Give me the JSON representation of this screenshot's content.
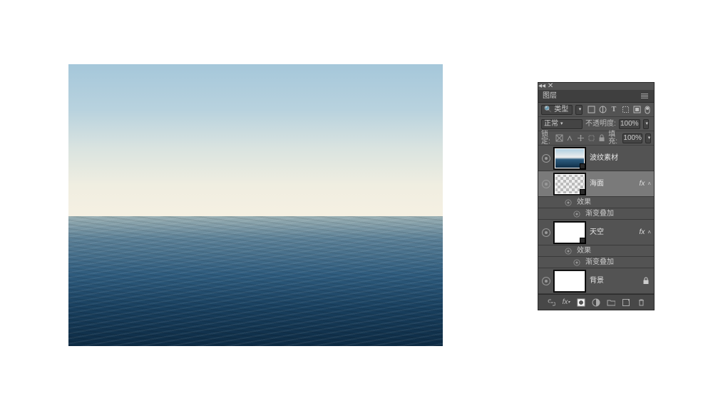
{
  "panel": {
    "title": "图层",
    "filter_label": "类型",
    "blend_mode": "正常",
    "opacity_label": "不透明度:",
    "opacity_value": "100%",
    "lock_label": "锁定:",
    "fill_label": "填充:",
    "fill_value": "100%"
  },
  "layers": [
    {
      "name": "波纹素材",
      "visible": true,
      "thumb": "sea",
      "selected": false,
      "fx": false,
      "locked": false
    },
    {
      "name": "海面",
      "visible": true,
      "thumb": "checker",
      "selected": true,
      "fx": true,
      "locked": false,
      "effects": {
        "label": "效果",
        "items": [
          "渐变叠加"
        ]
      }
    },
    {
      "name": "天空",
      "visible": true,
      "thumb": "white",
      "selected": false,
      "fx": true,
      "locked": false,
      "effects": {
        "label": "效果",
        "items": [
          "渐变叠加"
        ]
      }
    },
    {
      "name": "背景",
      "visible": true,
      "thumb": "white",
      "selected": false,
      "fx": false,
      "locked": true
    }
  ],
  "fx_glyph": "fx",
  "effects_heading": "效果",
  "effect_gradient_overlay": "渐变叠加"
}
